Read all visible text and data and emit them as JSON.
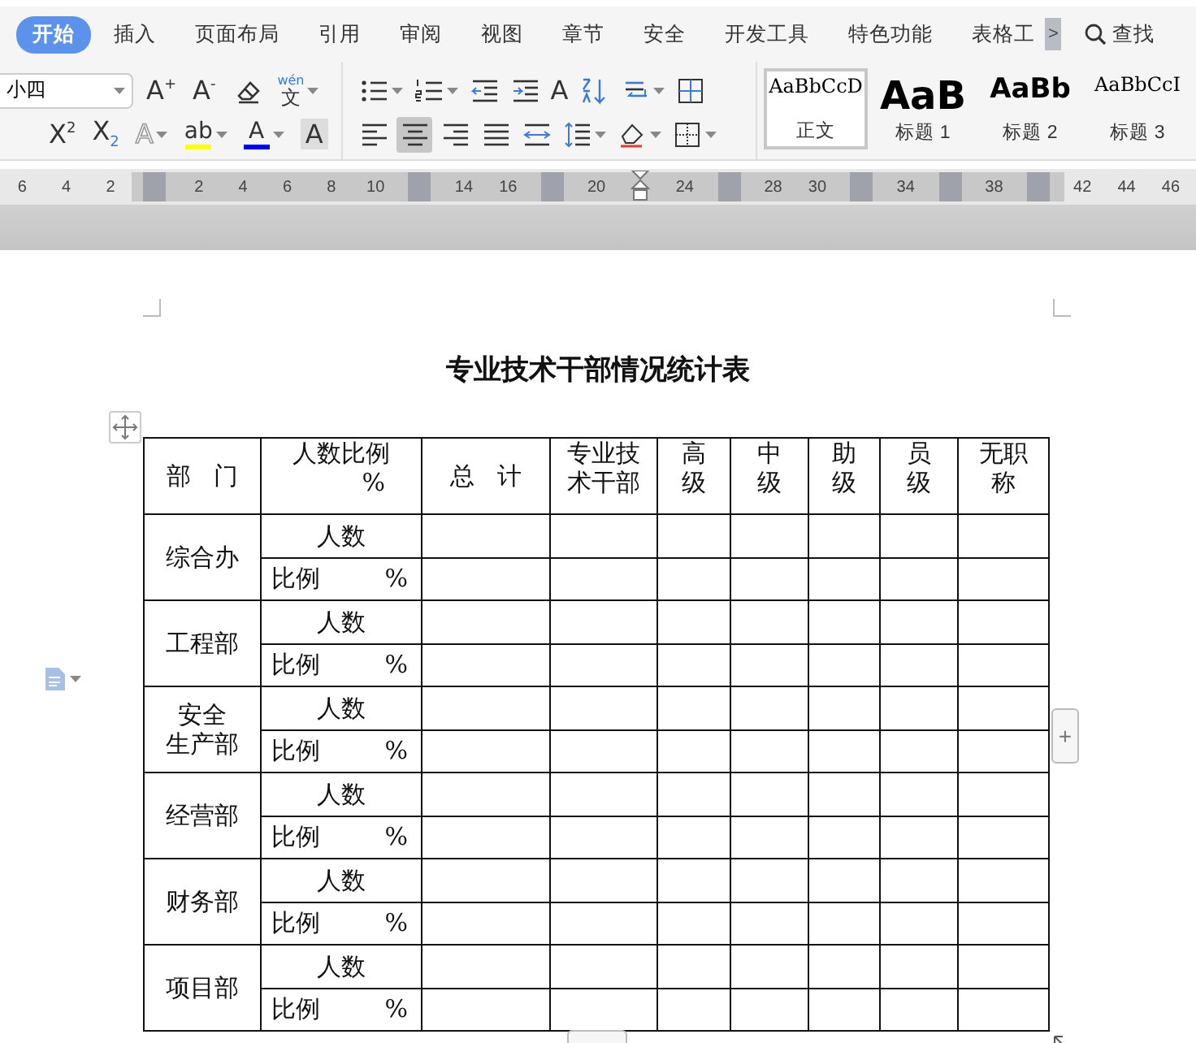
{
  "tabs": [
    {
      "label": "开始",
      "selected": true
    },
    {
      "label": "插入",
      "selected": false
    },
    {
      "label": "页面布局",
      "selected": false
    },
    {
      "label": "引用",
      "selected": false
    },
    {
      "label": "审阅",
      "selected": false
    },
    {
      "label": "视图",
      "selected": false
    },
    {
      "label": "章节",
      "selected": false
    },
    {
      "label": "安全",
      "selected": false
    },
    {
      "label": "开发工具",
      "selected": false
    },
    {
      "label": "特色功能",
      "selected": false
    },
    {
      "label": "表格工",
      "selected": false
    }
  ],
  "more_tabs": ">",
  "search": {
    "label": "查找"
  },
  "font_size": {
    "value": "小四"
  },
  "font_group": [
    [
      {
        "kind": "glyph",
        "text": "A$^{+}$",
        "selected": false
      },
      {
        "kind": "glyph",
        "text": "A$^{-}$",
        "selected": false
      },
      {
        "kind": "icon",
        "selected": false
      },
      {
        "kind": "phonetic",
        "ruby": "wén",
        "text": "文",
        "selected": false
      }
    ],
    [
      {
        "kind": "glyph",
        "text": "X$^{2}$",
        "selected": false
      },
      {
        "kind": "glyph",
        "text": "X$_{2}$",
        "selected": false
      },
      {
        "kind": "outline",
        "text": "A",
        "selected": false
      },
      {
        "kind": "color",
        "text": "ab",
        "color": "#ffff00",
        "selected": false
      },
      {
        "kind": "color",
        "text": "A",
        "color": "#0000ff",
        "selected": false
      },
      {
        "kind": "shaded",
        "text": "A",
        "selected": false
      }
    ]
  ],
  "para_group": [
    [
      {
        "kind": "icon",
        "selected": false
      },
      {
        "kind": "icon",
        "selected": false
      },
      {
        "kind": "icon",
        "selected": false
      },
      {
        "kind": "icon",
        "selected": false
      },
      {
        "kind": "glyph",
        "text": "A",
        "selected": false
      },
      {
        "kind": "icon",
        "selected": false
      },
      {
        "kind": "icon",
        "selected": false
      },
      {
        "kind": "icon",
        "selected": false
      }
    ],
    [
      {
        "kind": "icon",
        "selected": false
      },
      {
        "kind": "icon",
        "selected": true
      },
      {
        "kind": "icon",
        "selected": false
      },
      {
        "kind": "icon",
        "selected": false
      },
      {
        "kind": "icon",
        "selected": false
      },
      {
        "kind": "icon",
        "selected": false
      },
      {
        "kind": "icon",
        "selected": false
      },
      {
        "kind": "icon",
        "selected": false
      }
    ]
  ],
  "styles": [
    {
      "sample": "AaBbCcD",
      "name": "正文",
      "kind": "body",
      "selected": true
    },
    {
      "sample": "AaB",
      "name": "标题 1",
      "kind": "h1",
      "selected": false
    },
    {
      "sample": "AaBb",
      "name": "标题 2",
      "kind": "h2",
      "selected": false
    },
    {
      "sample": "AaBbCcI",
      "name": "标题 3",
      "kind": "h3",
      "selected": false
    }
  ],
  "ruler": [
    {
      "kind": "number",
      "label": "6"
    },
    {
      "kind": "number",
      "label": "4"
    },
    {
      "kind": "number",
      "label": "2"
    },
    {
      "kind": "marker"
    },
    {
      "kind": "number",
      "label": "2"
    },
    {
      "kind": "number",
      "label": "4"
    },
    {
      "kind": "number",
      "label": "6"
    },
    {
      "kind": "number",
      "label": "8"
    },
    {
      "kind": "number",
      "label": "10"
    },
    {
      "kind": "marker"
    },
    {
      "kind": "number",
      "label": "14"
    },
    {
      "kind": "number",
      "label": "16"
    },
    {
      "kind": "marker"
    },
    {
      "kind": "number",
      "label": "20"
    },
    {
      "kind": "indent"
    },
    {
      "kind": "number",
      "label": "24"
    },
    {
      "kind": "marker"
    },
    {
      "kind": "number",
      "label": "28"
    },
    {
      "kind": "number",
      "label": "30"
    },
    {
      "kind": "marker"
    },
    {
      "kind": "number",
      "label": "34"
    },
    {
      "kind": "marker"
    },
    {
      "kind": "number",
      "label": "38"
    },
    {
      "kind": "marker"
    },
    {
      "kind": "number",
      "label": "42"
    },
    {
      "kind": "number",
      "label": "44"
    },
    {
      "kind": "number",
      "label": "46"
    }
  ],
  "document": {
    "title": "专业技术干部情况统计表",
    "table": {
      "columns": [
        "部   门",
        "人数比例",
        "总   计",
        "专业技术干部",
        "高级",
        "中级",
        "助级",
        "员级",
        "无职称"
      ],
      "ratio_header_unit": "%",
      "departments": [
        {
          "name_lines": [
            "综合办"
          ],
          "count_label": "人数",
          "ratio_label": "比例",
          "ratio_unit": "%"
        },
        {
          "name_lines": [
            "工程部"
          ],
          "count_label": "人数",
          "ratio_label": "比例",
          "ratio_unit": "%"
        },
        {
          "name_lines": [
            "安全",
            "生产部"
          ],
          "count_label": "人数",
          "ratio_label": "比例",
          "ratio_unit": "%"
        },
        {
          "name_lines": [
            "经营部"
          ],
          "count_label": "人数",
          "ratio_label": "比例",
          "ratio_unit": "%"
        },
        {
          "name_lines": [
            "财务部"
          ],
          "count_label": "人数",
          "ratio_label": "比例",
          "ratio_unit": "%"
        },
        {
          "name_lines": [
            "项目部"
          ],
          "count_label": "人数",
          "ratio_label": "比例",
          "ratio_unit": "%"
        }
      ]
    }
  },
  "add_column_button": "+"
}
